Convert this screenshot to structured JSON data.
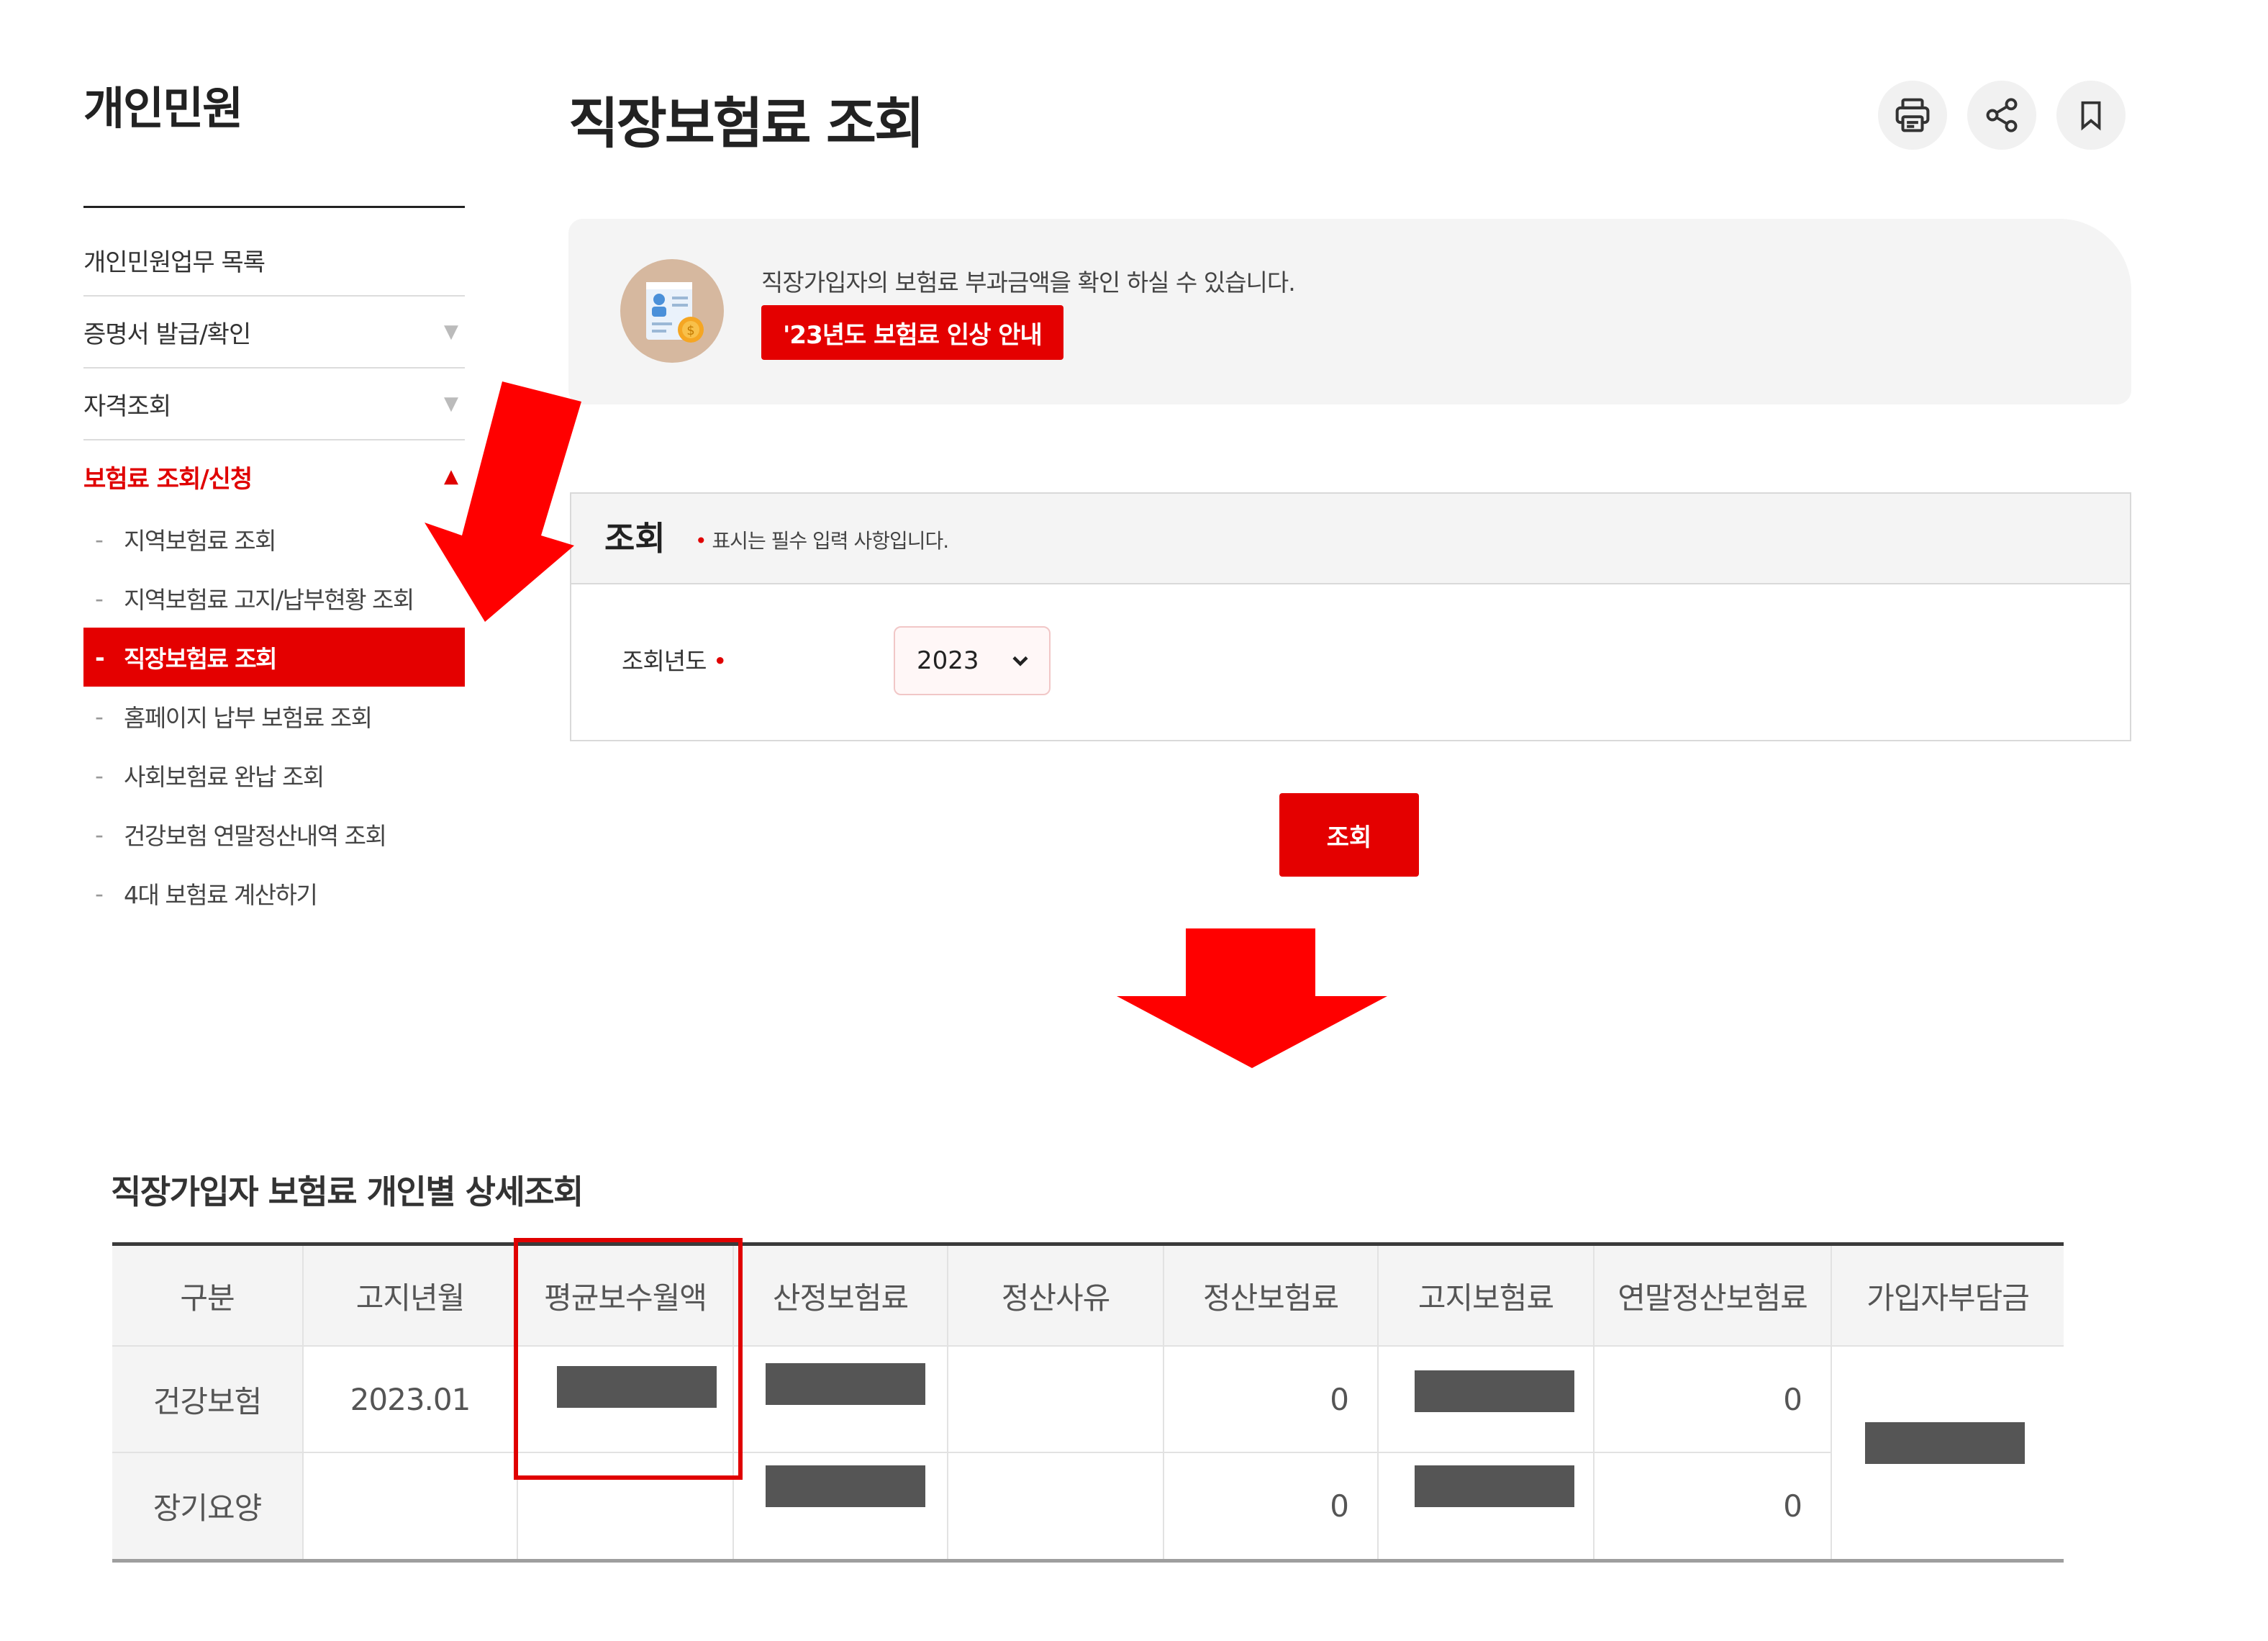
{
  "sidebar": {
    "title": "개인민원",
    "menu": [
      {
        "label": "개인민원업무 목록",
        "caret": ""
      },
      {
        "label": "증명서 발급/확인",
        "caret": "▼"
      },
      {
        "label": "자격조회",
        "caret": "▼"
      },
      {
        "label": "보험료 조회/신청",
        "caret": "▲",
        "active": true
      }
    ],
    "submenu": [
      {
        "label": "지역보험료 조회"
      },
      {
        "label": "지역보험료 고지/납부현황 조회"
      },
      {
        "label": "직장보험료 조회",
        "active": true
      },
      {
        "label": "홈페이지 납부 보험료 조회"
      },
      {
        "label": "사회보험료 완납 조회"
      },
      {
        "label": "건강보험 연말정산내역 조회"
      },
      {
        "label": "4대 보험료 계산하기"
      }
    ],
    "dash": "-"
  },
  "header": {
    "title": "직장보험료 조회",
    "tools": [
      "print-icon",
      "share-icon",
      "bookmark-icon"
    ]
  },
  "info": {
    "text": "직장가입자의 보험료 부과금액을 확인 하실 수 있습니다.",
    "notice_button": "'23년도 보험료 인상 안내"
  },
  "search": {
    "title": "조회",
    "required_note": "표시는 필수 입력 사항입니다.",
    "required_mark": "•",
    "year_label": "조회년도",
    "year_value": "2023",
    "submit_label": "조회"
  },
  "result": {
    "title": "직장가입자 보험료 개인별 상세조회",
    "columns": [
      "구분",
      "고지년월",
      "평균보수월액",
      "산정보험료",
      "정산사유",
      "정산보험료",
      "고지보험료",
      "연말정산보험료",
      "가입자부담금"
    ],
    "rows": [
      {
        "type": "건강보험",
        "month": "2023.01",
        "avg_pay": "",
        "calc": "",
        "reason": "",
        "settle": "0",
        "billed": "",
        "yearend": "0"
      },
      {
        "type": "장기요양",
        "month": "",
        "avg_pay": "",
        "calc": "",
        "reason": "",
        "settle": "0",
        "billed": "",
        "yearend": "0"
      }
    ]
  },
  "colors": {
    "accent": "#e40000",
    "annotation": "#ff0000"
  }
}
